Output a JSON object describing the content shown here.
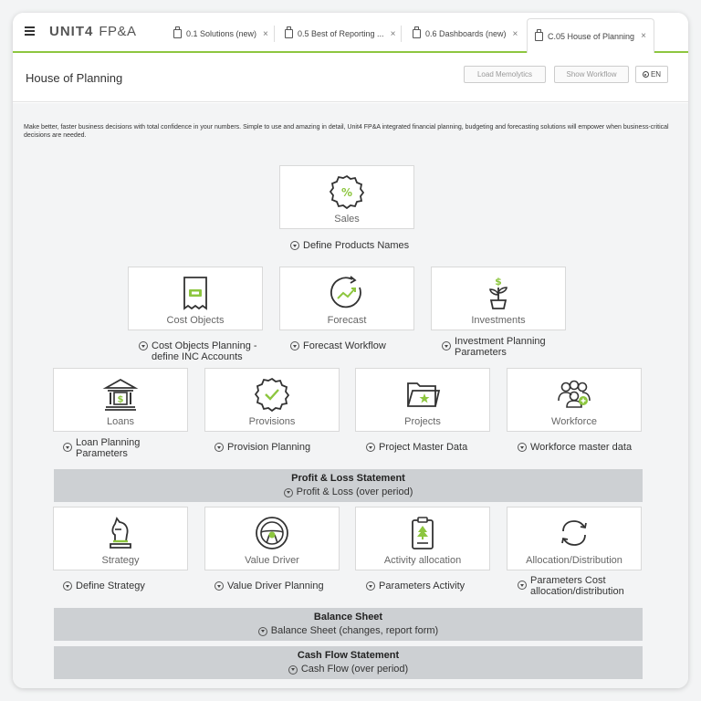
{
  "app": {
    "logo": "UNIT4",
    "product": "FP&A"
  },
  "tabs": [
    {
      "label": "0.1 Solutions (new)"
    },
    {
      "label": "0.5 Best of Reporting ..."
    },
    {
      "label": "0.6 Dashboards (new)"
    },
    {
      "label": "C.05 House of Planning"
    }
  ],
  "tab_close": "×",
  "header": {
    "title": "House of Planning",
    "load_button": "Load Memolytics",
    "workflow_button": "Show Workflow",
    "lang": "EN"
  },
  "intro": "Make better, faster business decisions with total confidence in your numbers. Simple to use and amazing in detail, Unit4 FP&A integrated financial planning, budgeting and forecasting solutions will empower when business-critical decisions are needed.",
  "cards": {
    "sales": {
      "label": "Sales",
      "link": "Define Products Names"
    },
    "cost_objects": {
      "label": "Cost Objects",
      "link": "Cost Objects Planning - define INC Accounts"
    },
    "forecast": {
      "label": "Forecast",
      "link": "Forecast Workflow"
    },
    "investments": {
      "label": "Investments",
      "link": "Investment Planning Parameters"
    },
    "loans": {
      "label": "Loans",
      "link": "Loan Planning Parameters"
    },
    "provisions": {
      "label": "Provisions",
      "link": "Provision Planning"
    },
    "projects": {
      "label": "Projects",
      "link": "Project Master Data"
    },
    "workforce": {
      "label": "Workforce",
      "link": "Workforce master data"
    },
    "strategy": {
      "label": "Strategy",
      "link": "Define Strategy"
    },
    "value_driver": {
      "label": "Value Driver",
      "link": "Value Driver Planning"
    },
    "activity": {
      "label": "Activity allocation",
      "link": "Parameters Activity"
    },
    "allocation": {
      "label": "Allocation/Distribution",
      "link": "Parameters Cost allocation/distribution"
    }
  },
  "bands": {
    "pl": {
      "title": "Profit & Loss Statement",
      "link": "Profit & Loss (over period)"
    },
    "bs": {
      "title": "Balance Sheet",
      "link": "Balance Sheet (changes, report form)"
    },
    "cf": {
      "title": "Cash Flow Statement",
      "link": "Cash Flow (over period)"
    }
  },
  "accent_color": "#8dc63f"
}
